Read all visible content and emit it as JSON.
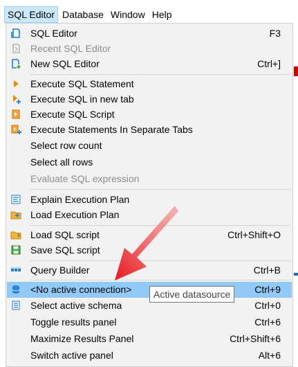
{
  "menubar": {
    "items": [
      {
        "label": "SQL Editor"
      },
      {
        "label": "Database"
      },
      {
        "label": "Window"
      },
      {
        "label": "Help"
      }
    ]
  },
  "menu": {
    "items": [
      {
        "label": "SQL Editor",
        "shortcut": "F3"
      },
      {
        "label": "Recent SQL Editor",
        "shortcut": ""
      },
      {
        "label": "New SQL Editor",
        "shortcut": "Ctrl+]"
      },
      {
        "label": "Execute SQL Statement",
        "shortcut": ""
      },
      {
        "label": "Execute SQL in new tab",
        "shortcut": ""
      },
      {
        "label": "Execute SQL Script",
        "shortcut": ""
      },
      {
        "label": "Execute Statements In Separate Tabs",
        "shortcut": ""
      },
      {
        "label": "Select row count",
        "shortcut": ""
      },
      {
        "label": "Select all rows",
        "shortcut": ""
      },
      {
        "label": "Evaluate SQL expression",
        "shortcut": ""
      },
      {
        "label": "Explain Execution Plan",
        "shortcut": ""
      },
      {
        "label": "Load Execution Plan",
        "shortcut": ""
      },
      {
        "label": "Load SQL script",
        "shortcut": "Ctrl+Shift+O"
      },
      {
        "label": "Save SQL script",
        "shortcut": ""
      },
      {
        "label": "Query Builder",
        "shortcut": "Ctrl+B"
      },
      {
        "label": "<No active connection>",
        "shortcut": "Ctrl+9"
      },
      {
        "label": "Select active schema",
        "shortcut": "Ctrl+0"
      },
      {
        "label": "Toggle results panel",
        "shortcut": "Ctrl+6"
      },
      {
        "label": "Maximize Results Panel",
        "shortcut": "Ctrl+Shift+6"
      },
      {
        "label": "Switch active panel",
        "shortcut": "Alt+6"
      }
    ]
  },
  "tooltip": {
    "text": "Active datasource"
  },
  "colors": {
    "highlight": "#91c9f7",
    "menubar_active": "#cce8ff",
    "arrow": "#e8161c",
    "icon_blue": "#1f7fd1",
    "icon_orange": "#f08a00"
  }
}
